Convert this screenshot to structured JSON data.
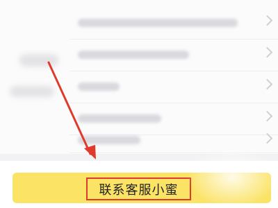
{
  "contact": {
    "label": "联系客服小蜜"
  },
  "colors": {
    "button": "#fbe366",
    "highlight": "#e03a2c",
    "arrow": "#e03a2c"
  },
  "list": {
    "rows": 5,
    "icon": "chevron-right-icon"
  }
}
